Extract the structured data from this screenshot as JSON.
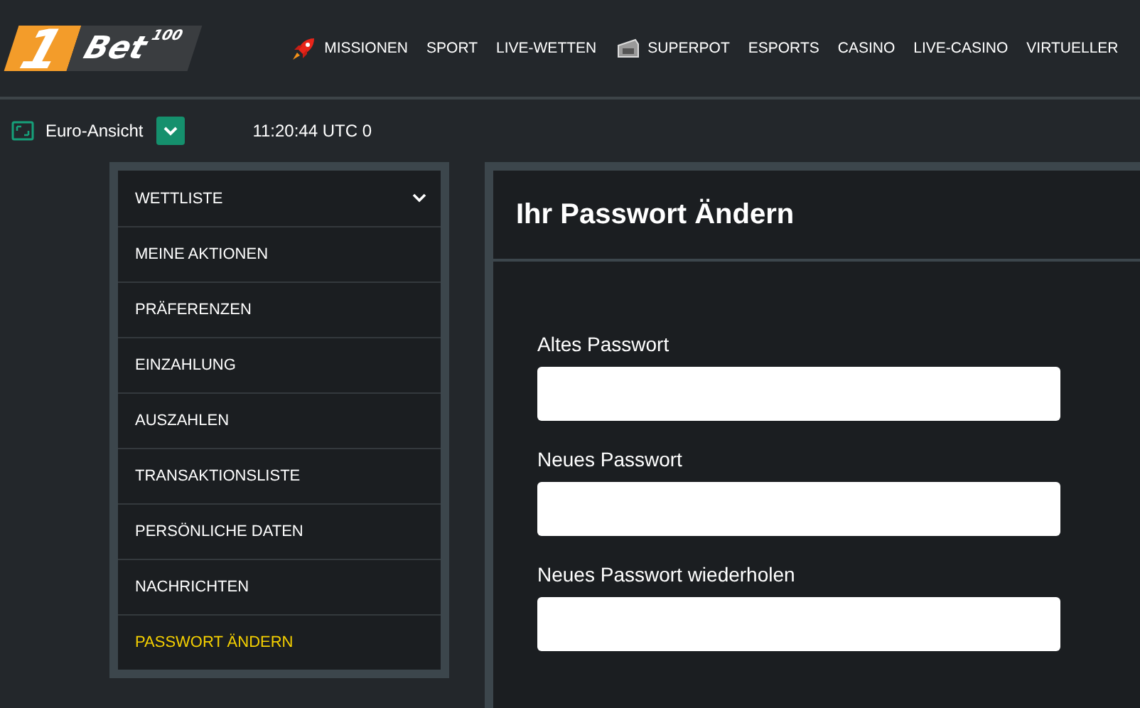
{
  "logo": {
    "numeral": "1",
    "name": "Bet",
    "superscript": "100"
  },
  "nav": [
    {
      "label": "MISSIONEN",
      "kind": "missions"
    },
    {
      "label": "SPORT",
      "kind": "plain"
    },
    {
      "label": "LIVE-WETTEN",
      "kind": "plain"
    },
    {
      "label": "SUPERPOT",
      "kind": "jackpot"
    },
    {
      "label": "ESPORTS",
      "kind": "plain"
    },
    {
      "label": "CASINO",
      "kind": "plain"
    },
    {
      "label": "LIVE-CASINO",
      "kind": "plain"
    },
    {
      "label": "VIRTUELLER",
      "kind": "plain"
    }
  ],
  "toolbar": {
    "view": "Euro-Ansicht",
    "time": "11:20:44 UTC 0"
  },
  "sidebar": {
    "items": [
      {
        "label": "WETTLISTE",
        "kind": "dropdown",
        "selected": false
      },
      {
        "label": "MEINE AKTIONEN",
        "kind": "link",
        "selected": false
      },
      {
        "label": "PRÄFERENZEN",
        "kind": "link",
        "selected": false
      },
      {
        "label": "EINZAHLUNG",
        "kind": "link",
        "selected": false
      },
      {
        "label": "AUSZAHLEN",
        "kind": "link",
        "selected": false
      },
      {
        "label": "TRANSAKTIONSLISTE",
        "kind": "link",
        "selected": false
      },
      {
        "label": "PERSÖNLICHE DATEN",
        "kind": "link",
        "selected": false
      },
      {
        "label": "NACHRICHTEN",
        "kind": "link",
        "selected": false
      },
      {
        "label": "PASSWORT ÄNDERN",
        "kind": "link",
        "selected": true
      }
    ]
  },
  "panel": {
    "title": "Ihr Passwort Ändern",
    "fields": [
      {
        "label": "Altes Passwort"
      },
      {
        "label": "Neues Passwort"
      },
      {
        "label": "Neues Passwort wiederholen"
      }
    ]
  }
}
